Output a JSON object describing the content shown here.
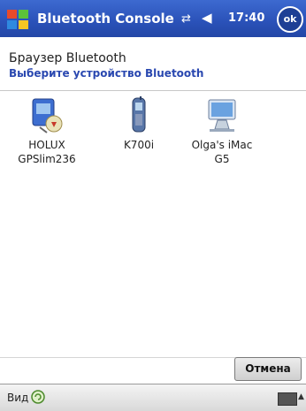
{
  "titlebar": {
    "title": "Bluetooth Console",
    "time": "17:40",
    "ok_label": "ok"
  },
  "header": {
    "title": "Браузер Bluetooth",
    "subtitle": "Выберите устройство Bluetooth"
  },
  "devices": [
    {
      "label_line1": "HOLUX",
      "label_line2": "GPSlim236"
    },
    {
      "label_line1": "K700i",
      "label_line2": ""
    },
    {
      "label_line1": "Olga's iMac",
      "label_line2": "G5"
    }
  ],
  "actions": {
    "cancel_label": "Отмена"
  },
  "menubar": {
    "view_label": "Вид"
  }
}
